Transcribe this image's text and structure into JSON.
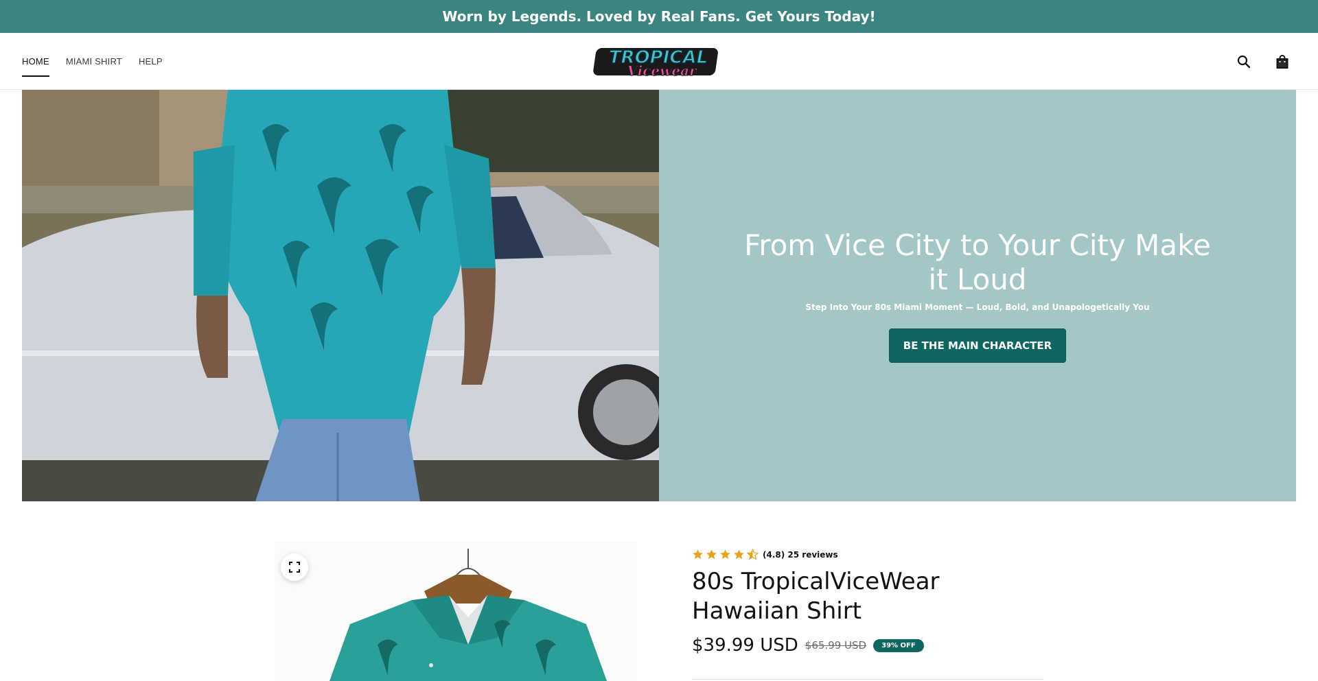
{
  "announcement": {
    "text": " Worn by Legends. Loved by Real Fans. Get Yours Today!"
  },
  "nav": {
    "items": [
      {
        "label": "HOME",
        "active": true
      },
      {
        "label": "MIAMI SHIRT",
        "active": false
      },
      {
        "label": "HELP",
        "active": false
      }
    ]
  },
  "logo": {
    "line1": "TROPICAL",
    "line2": "Vicewear"
  },
  "header_icons": {
    "search": "search-icon",
    "cart": "bag-icon"
  },
  "hero": {
    "title": "From Vice City to Your City Make it Loud",
    "subtitle": "Step Into Your 80s Miami Moment — Loud, Bold, and Unapologetically You",
    "button_label": "BE THE MAIN CHARACTER"
  },
  "product": {
    "rating_stars": 4.5,
    "rating_text": "(4.8) 25 reviews",
    "title": "80s TropicalViceWear Hawaiian Shirt",
    "price": "$39.99 USD",
    "compare_price": "$65.99 USD",
    "discount_badge": "39% OFF"
  },
  "colors": {
    "announcement_bg": "#3a8580",
    "hero_panel_bg": "#a3c7c6",
    "button_bg": "#0f6661",
    "star": "#e8a31c"
  }
}
